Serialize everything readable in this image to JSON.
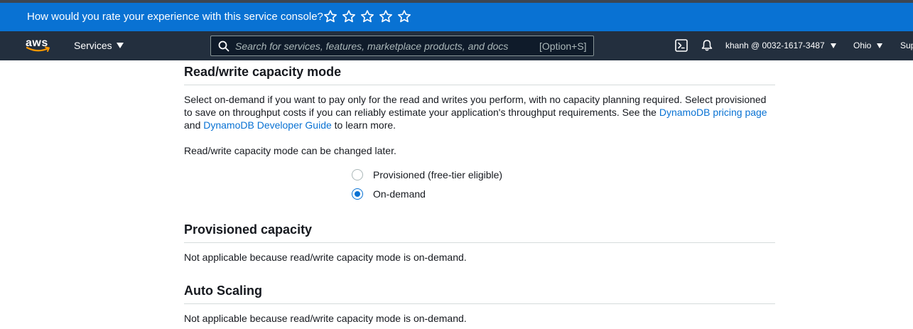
{
  "feedback": {
    "question": "How would you rate your experience with this service console?",
    "star_count": 5
  },
  "nav": {
    "logo_text": "aws",
    "services_label": "Services",
    "search_placeholder": "Search for services, features, marketplace products, and docs",
    "search_shortcut": "[Option+S]",
    "account_label": "khanh @ 0032-1617-3487",
    "region_label": "Ohio",
    "support_label": "Support"
  },
  "capacity_mode": {
    "title": "Read/write capacity mode",
    "description_part1": "Select on-demand if you want to pay only for the read and writes you perform, with no capacity planning required. Select provisioned to save on throughput costs if you can reliably estimate your application's throughput requirements. See the ",
    "pricing_link": "DynamoDB pricing page",
    "description_and": " and ",
    "guide_link": "DynamoDB Developer Guide",
    "description_end": " to learn more.",
    "change_note": "Read/write capacity mode can be changed later.",
    "options": [
      {
        "label": "Provisioned (free-tier eligible)",
        "selected": false
      },
      {
        "label": "On-demand",
        "selected": true
      }
    ]
  },
  "provisioned_capacity": {
    "title": "Provisioned capacity",
    "text": "Not applicable because read/write capacity mode is on-demand."
  },
  "auto_scaling": {
    "title": "Auto Scaling",
    "text": "Not applicable because read/write capacity mode is on-demand."
  },
  "colors": {
    "feedback_bar": "#0972d3",
    "nav_bar": "#232f3e",
    "link": "#0972d3",
    "smile": "#ff9900"
  }
}
